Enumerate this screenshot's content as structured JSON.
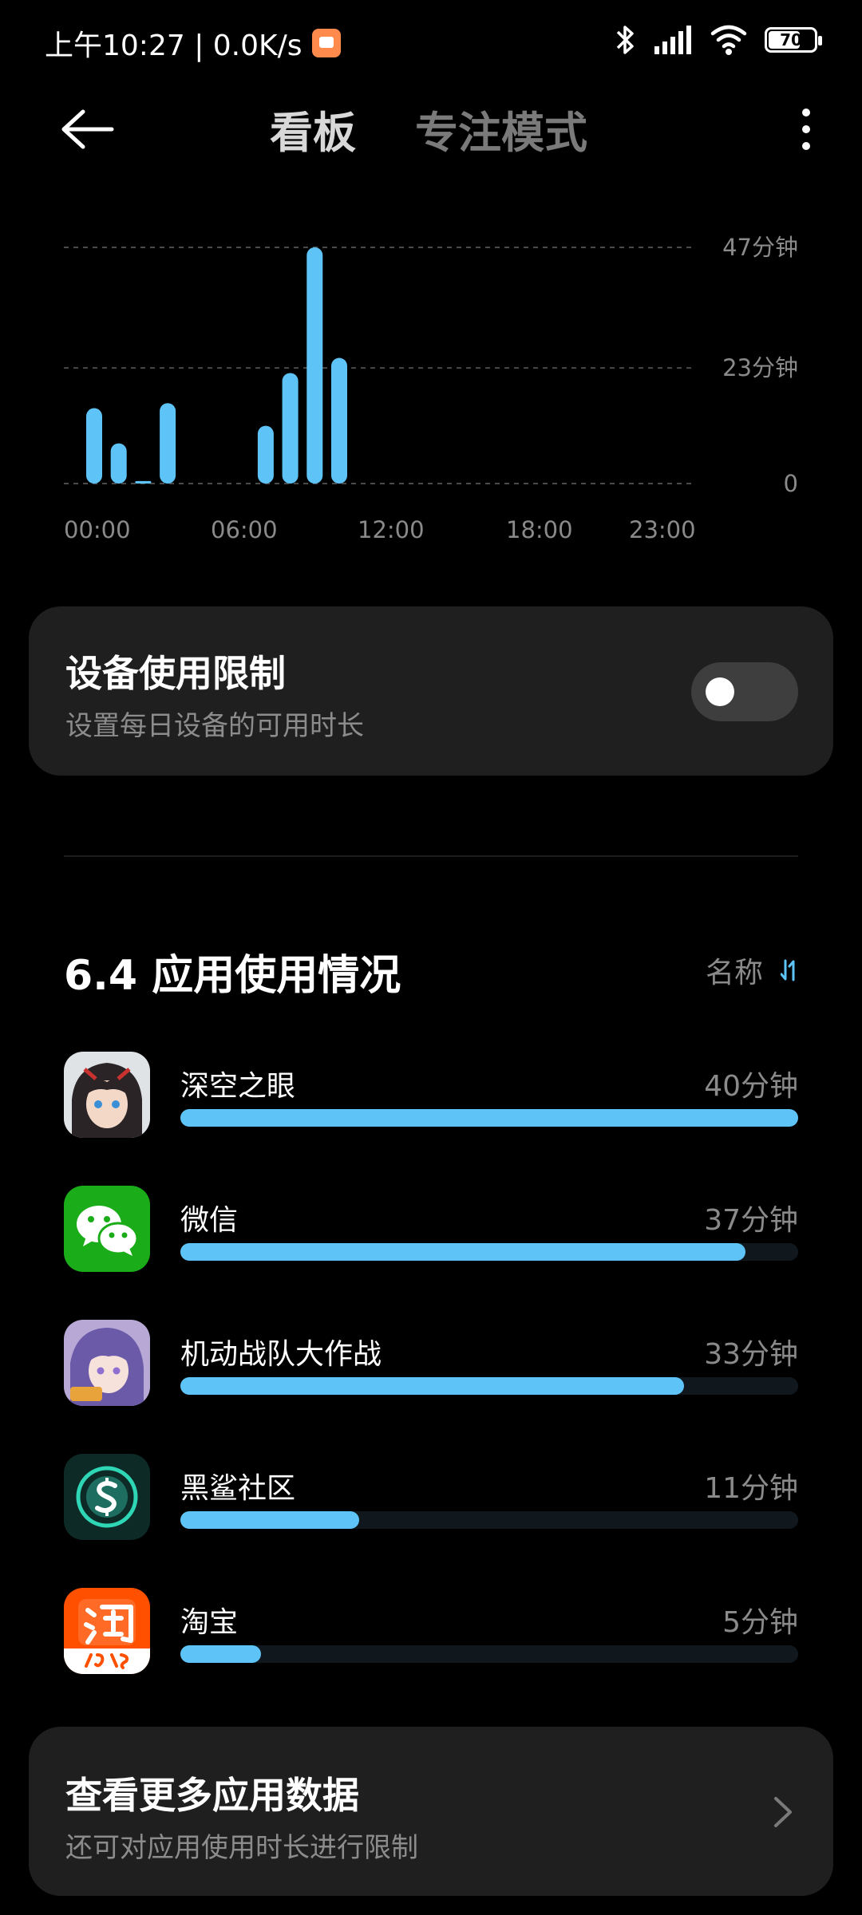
{
  "status_bar": {
    "time_text": "上午10:27 | 0.0K/s",
    "battery_level": "70",
    "battery_fraction": 0.7
  },
  "header": {
    "tabs": [
      {
        "label": "看板",
        "active": true
      },
      {
        "label": "专注模式",
        "active": false
      }
    ]
  },
  "chart_data": {
    "type": "bar",
    "x": [
      "00:00",
      "01:00",
      "02:00",
      "03:00",
      "04:00",
      "05:00",
      "06:00",
      "07:00",
      "08:00",
      "09:00",
      "10:00",
      "11:00",
      "12:00",
      "13:00",
      "14:00",
      "15:00",
      "16:00",
      "17:00",
      "18:00",
      "19:00",
      "20:00",
      "21:00",
      "22:00",
      "23:00"
    ],
    "values": [
      15,
      8,
      0.5,
      16,
      0,
      0,
      0,
      11.5,
      22,
      47,
      25,
      0,
      0,
      0,
      0,
      0,
      0,
      0,
      0,
      0,
      0,
      0,
      0,
      0
    ],
    "y_ticks": [
      "47分钟",
      "23分钟",
      "0"
    ],
    "y_tick_values": [
      47,
      23,
      0
    ],
    "x_ticks": [
      "00:00",
      "06:00",
      "12:00",
      "18:00",
      "23:00"
    ],
    "ylim": [
      0,
      47
    ],
    "grid": true,
    "bar_color": "#5ec4f8"
  },
  "device_limit": {
    "title": "设备使用限制",
    "subtitle": "设置每日设备的可用时长",
    "enabled": false
  },
  "usage": {
    "title": "6.4 应用使用情况",
    "sort_label": "名称",
    "apps": [
      {
        "name": "深空之眼",
        "time": "40分钟",
        "fraction": 1.0,
        "icon": "game-character-icon"
      },
      {
        "name": "微信",
        "time": "37分钟",
        "fraction": 0.915,
        "icon": "wechat-icon"
      },
      {
        "name": "机动战队大作战",
        "time": "33分钟",
        "fraction": 0.815,
        "icon": "game-girl-icon"
      },
      {
        "name": "黑鲨社区",
        "time": "11分钟",
        "fraction": 0.29,
        "icon": "blackshark-icon"
      },
      {
        "name": "淘宝",
        "time": "5分钟",
        "fraction": 0.13,
        "icon": "taobao-icon"
      }
    ]
  },
  "more_data": {
    "title": "查看更多应用数据",
    "subtitle": "还可对应用使用时长进行限制"
  },
  "colors": {
    "accent": "#5ec4f8",
    "card_bg": "#1f1f1f",
    "wechat_green": "#1aad19",
    "taobao_orange": "#ff5000"
  }
}
